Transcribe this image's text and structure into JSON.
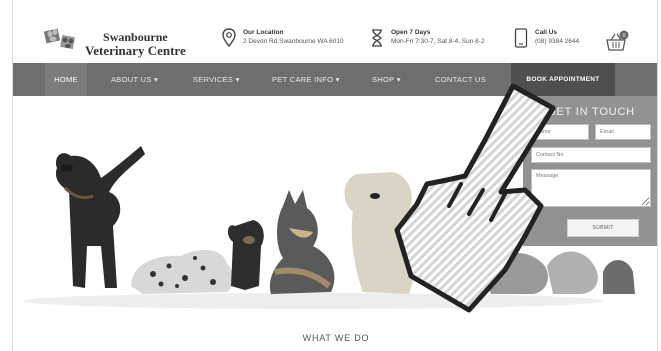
{
  "brand": {
    "name_line1": "Swanbourne",
    "name_line2": "Veterinary Centre"
  },
  "header_info": {
    "location": {
      "title": "Our Location",
      "detail": "2 Devon Rd Swanbourne WA 6010",
      "icon": "location-pin-icon"
    },
    "hours": {
      "title": "Open 7 Days",
      "detail": "Mon-Fri 7:30-7, Sat 8-4, Sun 8-2",
      "icon": "hourglass-icon"
    },
    "call": {
      "title": "Call Us",
      "detail": "(08) 9384 2644",
      "icon": "phone-icon"
    },
    "cart": {
      "icon": "shopping-basket-icon",
      "count": "0"
    }
  },
  "nav": {
    "items": [
      {
        "label": "HOME"
      },
      {
        "label": "ABOUT US ▾"
      },
      {
        "label": "SERVICES ▾"
      },
      {
        "label": "PET CARE INFO ▾"
      },
      {
        "label": "SHOP ▾"
      },
      {
        "label": "CONTACT US"
      }
    ],
    "book": "BOOK APPOINTMENT"
  },
  "contact_form": {
    "title": "GET IN TOUCH",
    "name_placeholder": "Name",
    "email_placeholder": "Email",
    "contact_placeholder": "Contact No",
    "message_placeholder": "Message",
    "submit": "SUBMIT"
  },
  "section": {
    "heading": "WHAT WE DO"
  },
  "colors": {
    "nav_bg": "#6e6e6e",
    "nav_active": "#7c7c7c",
    "book_bg": "#4f4f4f",
    "form_bg": "#8d8d8d"
  }
}
